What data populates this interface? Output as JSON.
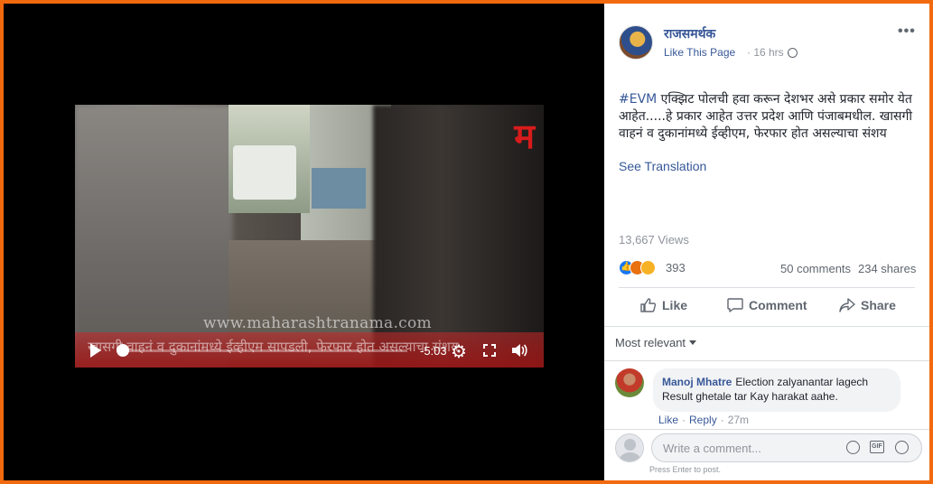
{
  "video": {
    "watermark_site": "www.maharashtranama.com",
    "caption_text": "खासगी वाहनं व दुकानांमध्ये ईव्हीएम सापडली, फेरफार होत असल्याचा संशय",
    "time_remaining": "-5:03",
    "progress_fraction": 0.0,
    "icons": [
      "play-icon",
      "settings-icon",
      "fullscreen-icon",
      "volume-icon"
    ]
  },
  "post": {
    "page_name": "राजसमर्थक",
    "like_page": "Like This Page",
    "time": "· 16 hrs ·",
    "hashtag": "#EVM",
    "text": " एक्झिट पोलची हवा करून देशभर असे प्रकार समोर येत आहेत.....हे प्रकार आहेत उत्तर प्रदेश आणि पंजाबमधील. खासगी वाहनं व दुकानांमध्ये ईव्हीएम, फेरफार होत असल्याचा संशय",
    "see_translation": "See Translation",
    "views": "13,667 Views",
    "reaction_count": "393",
    "comments": "50 comments",
    "shares": "234 shares"
  },
  "actions": {
    "like": "Like",
    "comment": "Comment",
    "share": "Share"
  },
  "comments_section": {
    "sort_label": "Most relevant",
    "items": [
      {
        "author": "Manoj Mhatre",
        "text": "Election zalyanantar lagech Result ghetale tar Kay harakat aahe.",
        "like": "Like",
        "reply": "Reply",
        "time": "27m"
      }
    ],
    "composer_placeholder": "Write a comment...",
    "press_enter": "Press Enter to post."
  },
  "colors": {
    "border_accent": "#f26a0f",
    "link_blue": "#385898",
    "brand_red": "#d81b1b"
  }
}
